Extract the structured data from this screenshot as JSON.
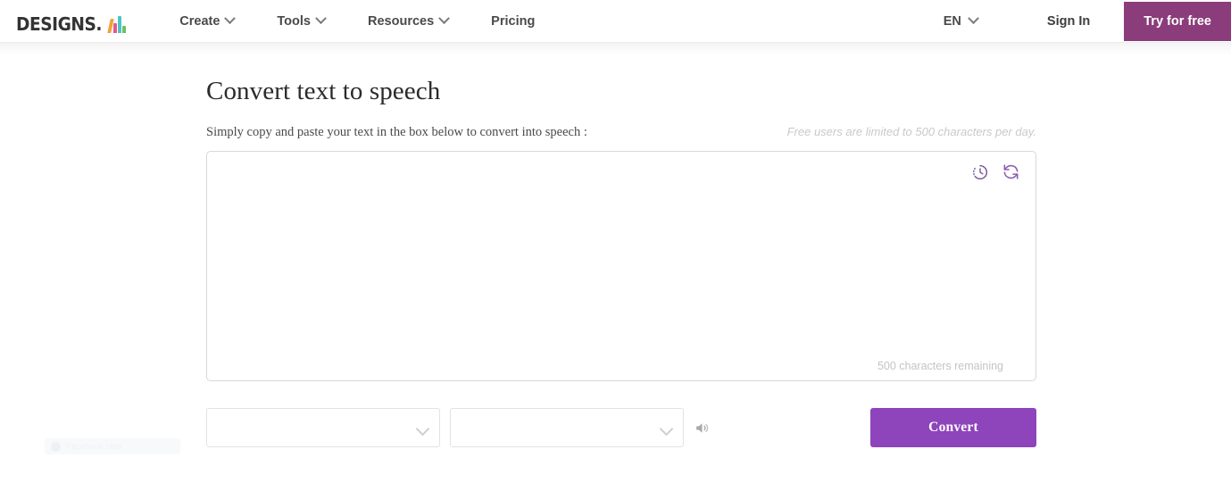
{
  "navbar": {
    "logo": {
      "text": "DESIGNS.",
      "mark_name": "ai-logo-mark",
      "bar_colors": [
        "#f0a33c",
        "#e8588c",
        "#4fc3c9",
        "#6ec05f"
      ]
    },
    "links": [
      {
        "label": "Create",
        "has_dropdown": true
      },
      {
        "label": "Tools",
        "has_dropdown": true
      },
      {
        "label": "Resources",
        "has_dropdown": true
      },
      {
        "label": "Pricing",
        "has_dropdown": false
      }
    ],
    "language": {
      "label": "EN",
      "has_dropdown": true
    },
    "signin_label": "Sign In",
    "cta_label": "Try for free",
    "cta_color": "#8a3d7a"
  },
  "main": {
    "title": "Convert text to speech",
    "subtitle": "Simply copy and paste your text in the box below to convert into speech :",
    "limit_note": "Free users are limited to 500 characters per day.",
    "textarea": {
      "value": "",
      "placeholder": "",
      "char_count": "500 characters remaining",
      "icons": [
        {
          "name": "history-clock-icon",
          "color": "#7a5a9e"
        },
        {
          "name": "refresh-sync-icon",
          "color": "#8a5fb0"
        }
      ]
    },
    "controls": {
      "language_select": {
        "value": "",
        "placeholder": ""
      },
      "voice_select": {
        "value": "",
        "placeholder": ""
      },
      "preview_icon": "speaker-volume-icon",
      "convert_label": "Convert",
      "convert_color": "#8e44ba"
    }
  },
  "chat_widget": {
    "label": "Facebook chat",
    "icon": "messenger-icon"
  }
}
